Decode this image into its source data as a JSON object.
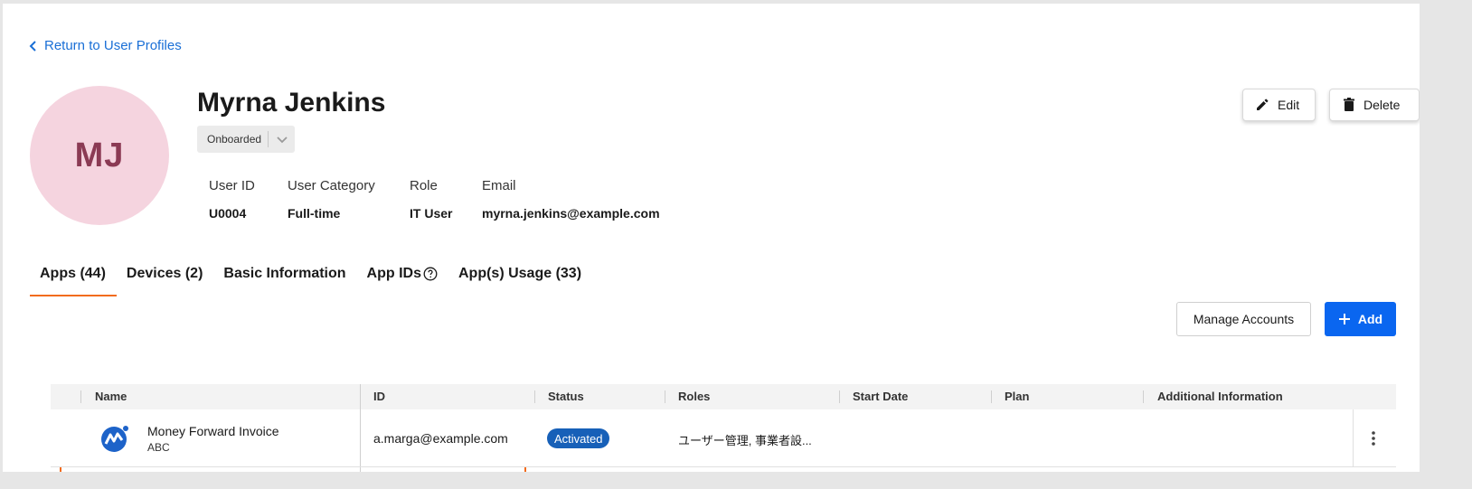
{
  "nav": {
    "back_label": "Return to User Profiles"
  },
  "user": {
    "initials": "MJ",
    "name": "Myrna Jenkins",
    "status": "Onboarded",
    "avatar_color": "#f5d4df",
    "initials_color": "#8b3a54"
  },
  "info": {
    "labels": [
      "User ID",
      "User Category",
      "Role",
      "Email"
    ],
    "values": [
      "U0004",
      "Full-time",
      "IT User",
      "myrna.jenkins@example.com"
    ]
  },
  "actions": {
    "edit_label": "Edit",
    "delete_label": "Delete"
  },
  "tabs": [
    {
      "label": "Apps (44)",
      "active": true
    },
    {
      "label": "Devices (2)"
    },
    {
      "label": "Basic Information"
    },
    {
      "label": "App IDs"
    },
    {
      "label": "App(s) Usage (33)"
    }
  ],
  "toolbar": {
    "manage_label": "Manage Accounts",
    "add_label": "Add"
  },
  "table": {
    "columns": [
      "Name",
      "ID",
      "Status",
      "Roles",
      "Start Date",
      "Plan",
      "Additional Information"
    ],
    "rows": [
      {
        "app_name": "Money Forward Invoice",
        "app_sub": "ABC",
        "id": "a.marga@example.com",
        "status": "Activated",
        "roles": "ユーザー管理, 事業者設...",
        "start_date": "",
        "plan": "",
        "additional": ""
      }
    ]
  },
  "colors": {
    "accent": "#f26b1d",
    "primary": "#0a66f0",
    "link": "#1a6fd6",
    "status_badge": "#1760b8"
  },
  "icons": [
    "chevron-left-icon",
    "chevron-down-icon",
    "pencil-icon",
    "trash-icon",
    "help-circle-icon",
    "plus-icon",
    "money-forward-logo",
    "more-vertical-icon"
  ]
}
